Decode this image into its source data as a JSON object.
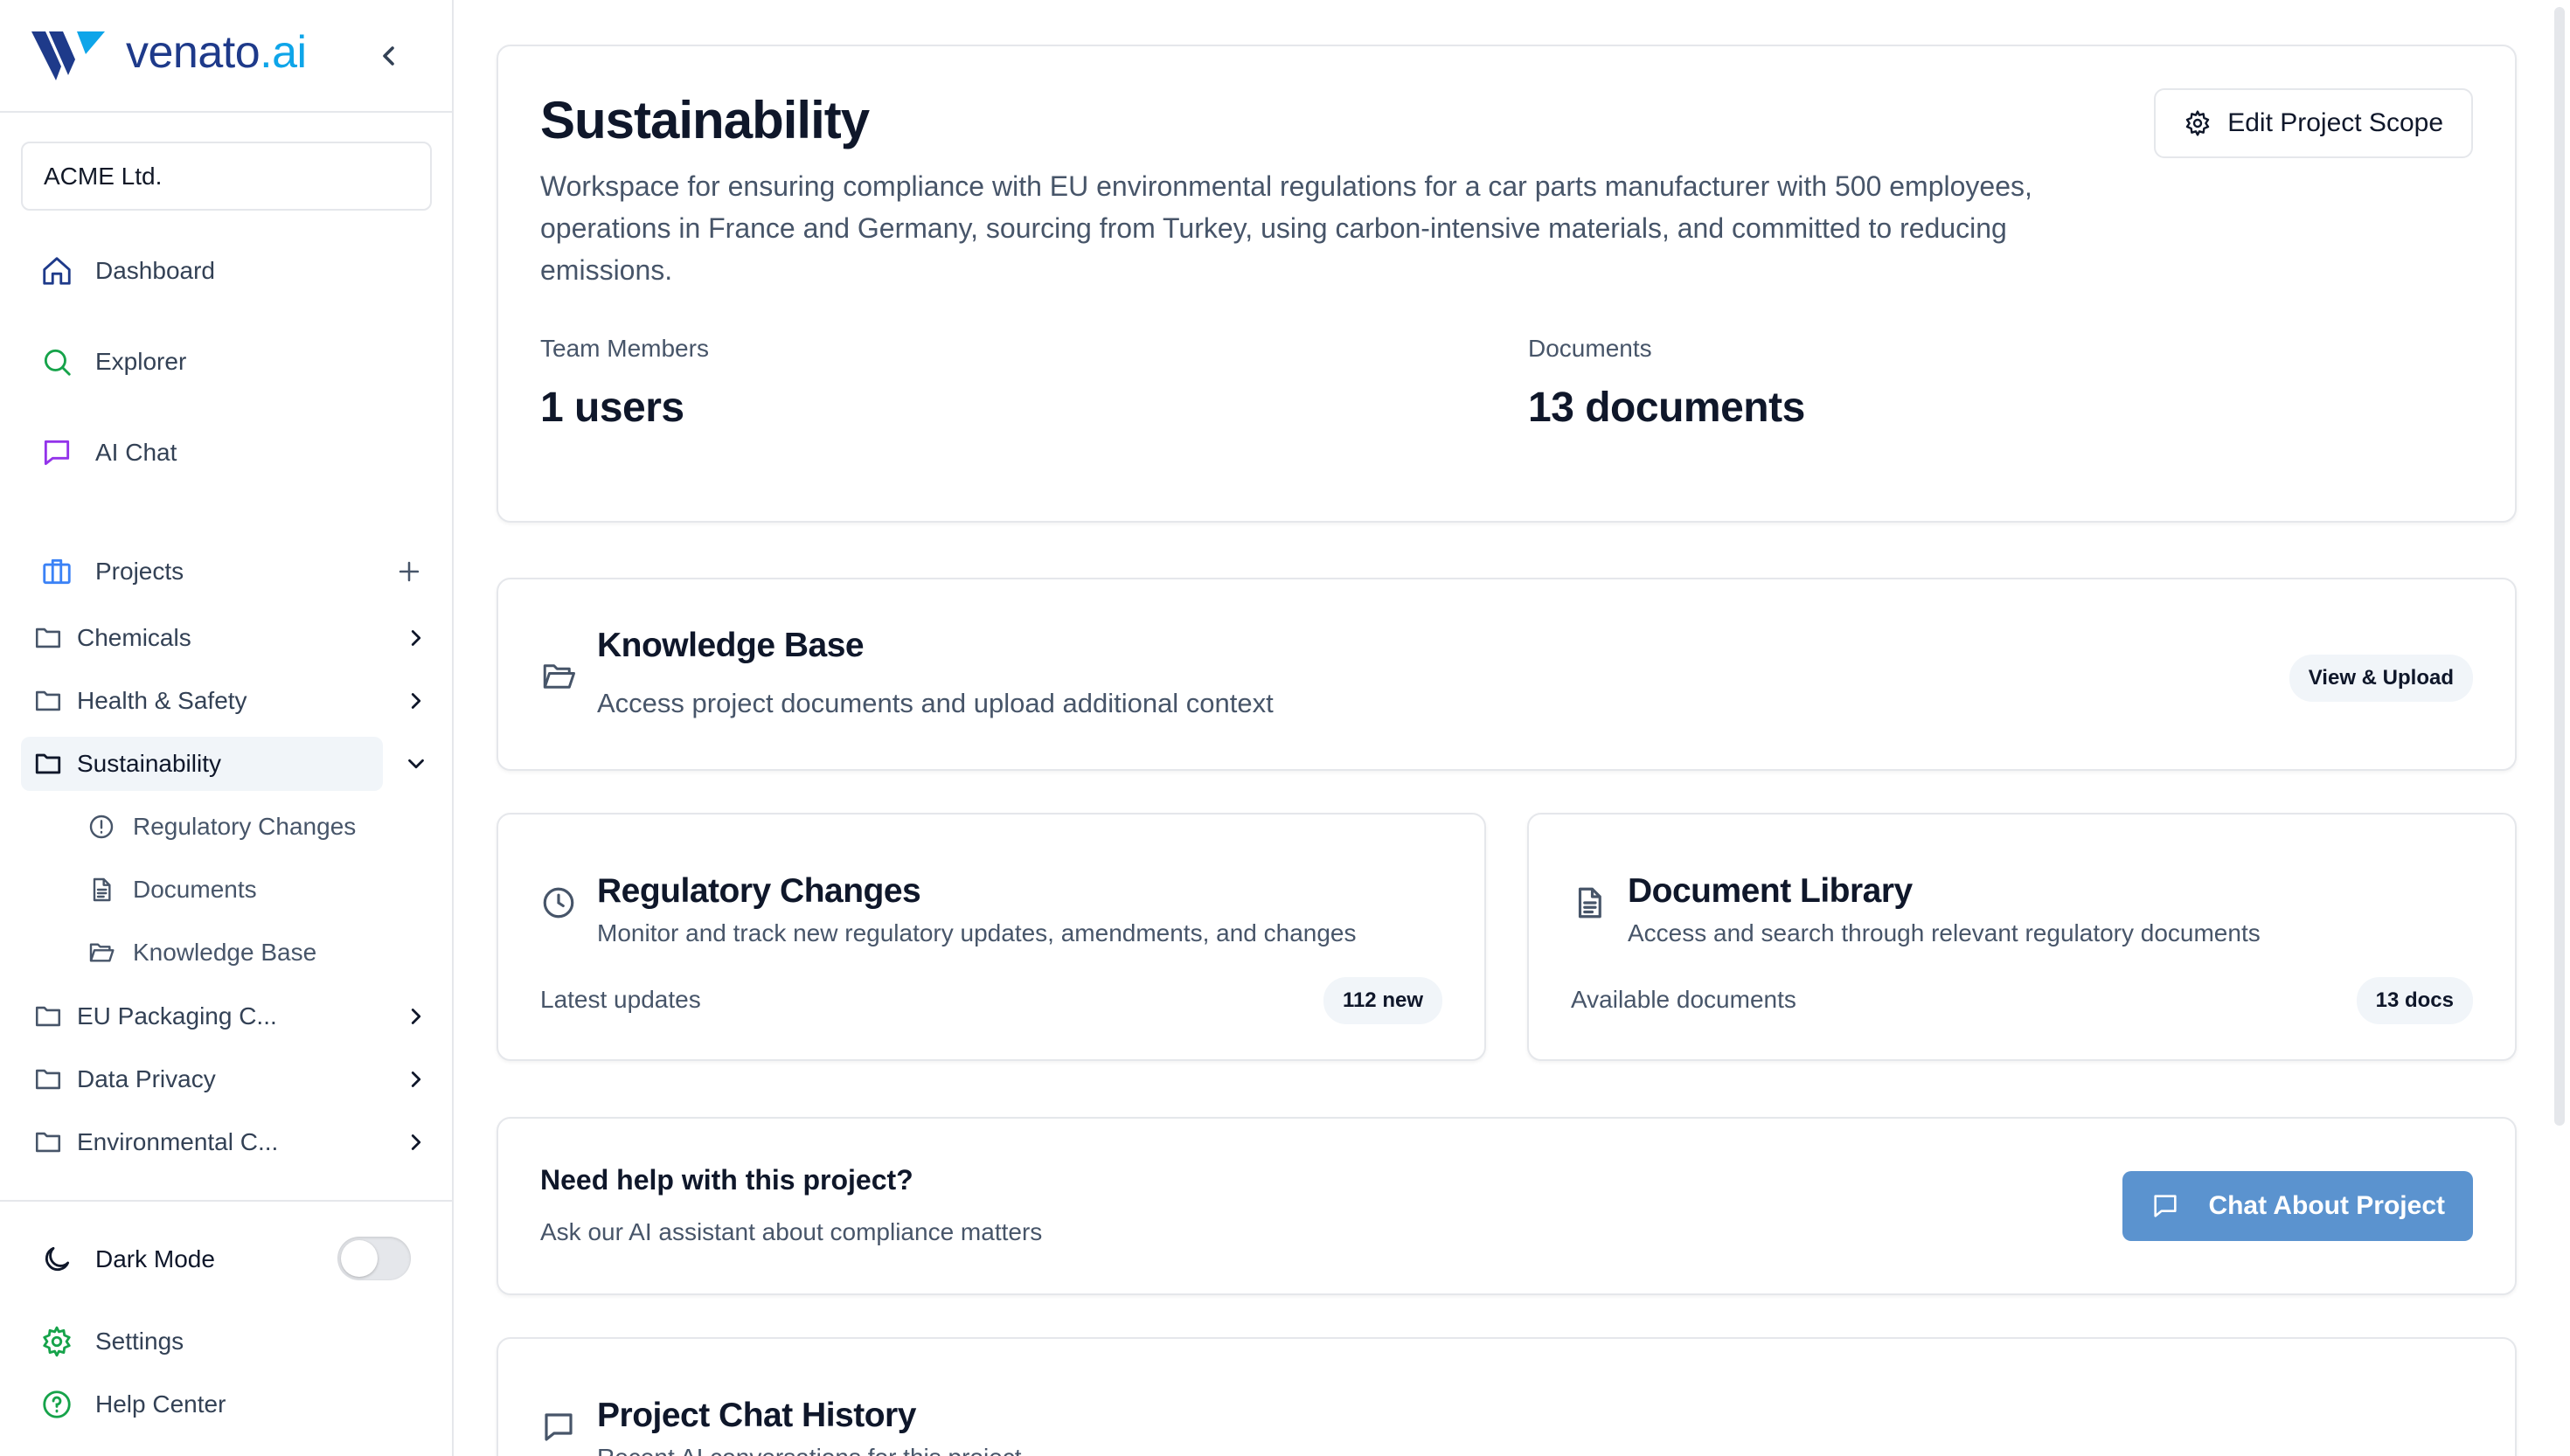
{
  "brand": {
    "name": "venato",
    "suffix": ".ai"
  },
  "org": {
    "selected": "ACME Ltd."
  },
  "nav": {
    "dashboard": "Dashboard",
    "explorer": "Explorer",
    "ai_chat": "AI Chat"
  },
  "projects": {
    "label": "Projects",
    "items": [
      {
        "label": "Chemicals"
      },
      {
        "label": "Health & Safety"
      },
      {
        "label": "Sustainability"
      },
      {
        "label": "EU Packaging C..."
      },
      {
        "label": "Data Privacy"
      },
      {
        "label": "Environmental C..."
      }
    ],
    "sub_items": [
      {
        "label": "Regulatory Changes"
      },
      {
        "label": "Documents"
      },
      {
        "label": "Knowledge Base"
      }
    ]
  },
  "footer": {
    "dark_mode": "Dark Mode",
    "dark_mode_enabled": false,
    "settings": "Settings",
    "help": "Help Center"
  },
  "project": {
    "title": "Sustainability",
    "description": "Workspace for ensuring compliance with EU environmental regulations for a car parts manufacturer with 500 employees, operations in France and Germany, sourcing from Turkey, using carbon-intensive materials, and committed to reducing emissions.",
    "edit_label": "Edit Project Scope",
    "team_label": "Team Members",
    "team_value": "1 users",
    "docs_label": "Documents",
    "docs_value": "13 documents"
  },
  "knowledge": {
    "title": "Knowledge Base",
    "subtitle": "Access project documents and upload additional context",
    "action": "View & Upload"
  },
  "regulatory": {
    "title": "Regulatory Changes",
    "subtitle": "Monitor and track new regulatory updates, amendments, and changes",
    "meta_label": "Latest updates",
    "badge": "112 new"
  },
  "library": {
    "title": "Document Library",
    "subtitle": "Access and search through relevant regulatory documents",
    "meta_label": "Available documents",
    "badge": "13 docs"
  },
  "help": {
    "title": "Need help with this project?",
    "subtitle": "Ask our AI assistant about compliance matters",
    "button": "Chat About Project"
  },
  "history": {
    "title": "Project Chat History",
    "subtitle": "Recent AI conversations for this project"
  },
  "colors": {
    "accent": "#5b93cf",
    "brand": "#1e3a8a",
    "brand_accent": "#0ea5e9"
  }
}
